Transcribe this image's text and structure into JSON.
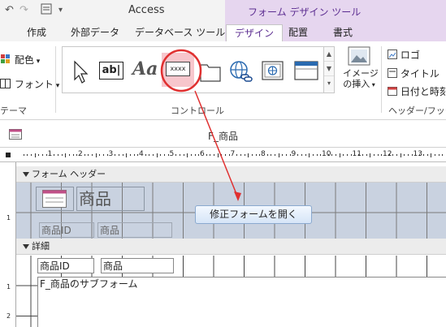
{
  "titlebar": {
    "app_title": "Access",
    "contextual_title": "フォーム デザイン ツール"
  },
  "tabs": [
    {
      "label": "作成"
    },
    {
      "label": "外部データ"
    },
    {
      "label": "データベース ツール"
    },
    {
      "label": "デザイン",
      "active": true
    },
    {
      "label": "配置"
    },
    {
      "label": "書式"
    }
  ],
  "ribbon": {
    "theme_group": {
      "colors_label": "配色",
      "fonts_label": "フォント",
      "group_label": "テーマ"
    },
    "controls_group": {
      "textbox_icon_label": "ab|",
      "label_icon_text": "Aa",
      "button_icon_text": "xxxx",
      "group_label": "コントロール",
      "controls": [
        "select-pointer-icon",
        "textbox-icon",
        "label-icon",
        "button-icon",
        "tab-control-icon",
        "hyperlink-icon",
        "web-browser-icon",
        "navigation-control-icon"
      ]
    },
    "insert_image": {
      "label_line1": "イメージ",
      "label_line2": "の挿入"
    },
    "header_group": {
      "logo_label": "ロゴ",
      "title_label": "タイトル",
      "datetime_label": "日付と時刻",
      "group_label": "ヘッダー/フッター"
    }
  },
  "document": {
    "tab_title": "F_商品",
    "ruler_numbers": [
      "1",
      "2",
      "3",
      "4",
      "5",
      "6",
      "7",
      "8",
      "9",
      "10",
      "11",
      "12",
      "13"
    ],
    "form_header": {
      "label": "フォーム ヘッダー",
      "title_text": "商品",
      "col_labels": [
        "商品ID",
        "商品"
      ]
    },
    "detail": {
      "label": "詳細",
      "fields": [
        "商品ID",
        "商品"
      ],
      "subform_label": "F_商品のサブフォーム"
    },
    "vruler_numbers": [
      "1",
      "1",
      "2"
    ]
  },
  "callout": {
    "button_text": "修正フォームを開く"
  },
  "colors": {
    "accent": "#5c2d91",
    "contextual_bg": "#e6d6ef",
    "annotation": "#e03030",
    "header_bg": "#c9d2e0"
  }
}
